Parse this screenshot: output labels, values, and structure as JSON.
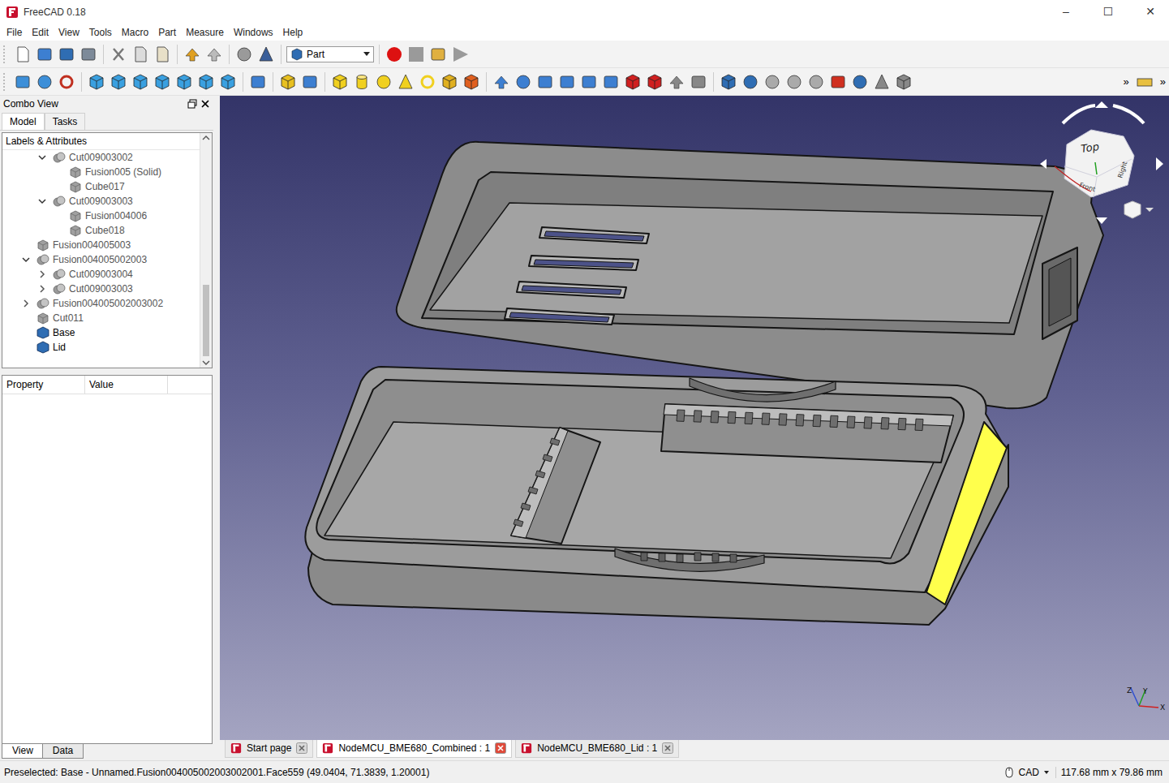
{
  "window": {
    "title": "FreeCAD 0.18",
    "controls": [
      "–",
      "☐",
      "✕"
    ]
  },
  "menu": [
    "File",
    "Edit",
    "View",
    "Tools",
    "Macro",
    "Part",
    "Measure",
    "Windows",
    "Help"
  ],
  "toolbar": {
    "workbench": "Part",
    "more": [
      "»",
      "»"
    ]
  },
  "combo_view": {
    "title": "Combo View"
  },
  "tabs": [
    {
      "label": "Model",
      "selected": true
    },
    {
      "label": "Tasks",
      "selected": false
    }
  ],
  "tree": {
    "header": "Labels & Attributes",
    "items": [
      {
        "label": "Cut009003002",
        "depth": 1,
        "kind": "compound",
        "hasChildren": true,
        "expanded": true
      },
      {
        "label": "Fusion005 (Solid)",
        "depth": 2,
        "kind": "solid",
        "hasChildren": false,
        "expanded": false
      },
      {
        "label": "Cube017",
        "depth": 2,
        "kind": "solid",
        "hasChildren": false,
        "expanded": false
      },
      {
        "label": "Cut009003003",
        "depth": 1,
        "kind": "compound",
        "hasChildren": true,
        "expanded": true
      },
      {
        "label": "Fusion004006",
        "depth": 2,
        "kind": "solid",
        "hasChildren": false,
        "expanded": false
      },
      {
        "label": "Cube018",
        "depth": 2,
        "kind": "solid",
        "hasChildren": false,
        "expanded": false
      },
      {
        "label": "Fusion004005003",
        "depth": 0,
        "kind": "solid",
        "hasChildren": false,
        "expanded": false
      },
      {
        "label": "Fusion004005002003",
        "depth": 0,
        "kind": "compound",
        "hasChildren": true,
        "expanded": true
      },
      {
        "label": "Cut009003004",
        "depth": 1,
        "kind": "compound",
        "hasChildren": true,
        "expanded": false
      },
      {
        "label": "Cut009003003",
        "depth": 1,
        "kind": "compound",
        "hasChildren": true,
        "expanded": false
      },
      {
        "label": "Fusion004005002003002",
        "depth": 0,
        "kind": "compound",
        "hasChildren": true,
        "expanded": false
      },
      {
        "label": "Cut011",
        "depth": 0,
        "kind": "solid",
        "hasChildren": false,
        "expanded": false
      },
      {
        "label": "Base",
        "depth": 0,
        "kind": "body",
        "hasChildren": false,
        "expanded": false
      },
      {
        "label": "Lid",
        "depth": 0,
        "kind": "body",
        "hasChildren": false,
        "expanded": false
      }
    ]
  },
  "properties": {
    "columns": [
      "Property",
      "Value"
    ]
  },
  "panel_tabs": [
    {
      "label": "View",
      "selected": true
    },
    {
      "label": "Data",
      "selected": false
    }
  ],
  "documents": [
    {
      "label": "Start page",
      "selected": false
    },
    {
      "label": "NodeMCU_BME680_Combined : 1",
      "selected": true
    },
    {
      "label": "NodeMCU_BME680_Lid : 1",
      "selected": false
    }
  ],
  "viewport": {
    "navcube": {
      "faces": [
        "Top",
        "Front",
        "Right"
      ]
    },
    "axes": [
      "Z",
      "Y",
      "X"
    ],
    "preselected_face": true
  },
  "status_bar": {
    "message": "Preselected: Base - Unnamed.Fusion004005002003002001.Face559 (49.0404, 71.3839, 1.20001)",
    "navigation": "CAD",
    "dimensions": "117.68 mm x 79.86 mm"
  }
}
